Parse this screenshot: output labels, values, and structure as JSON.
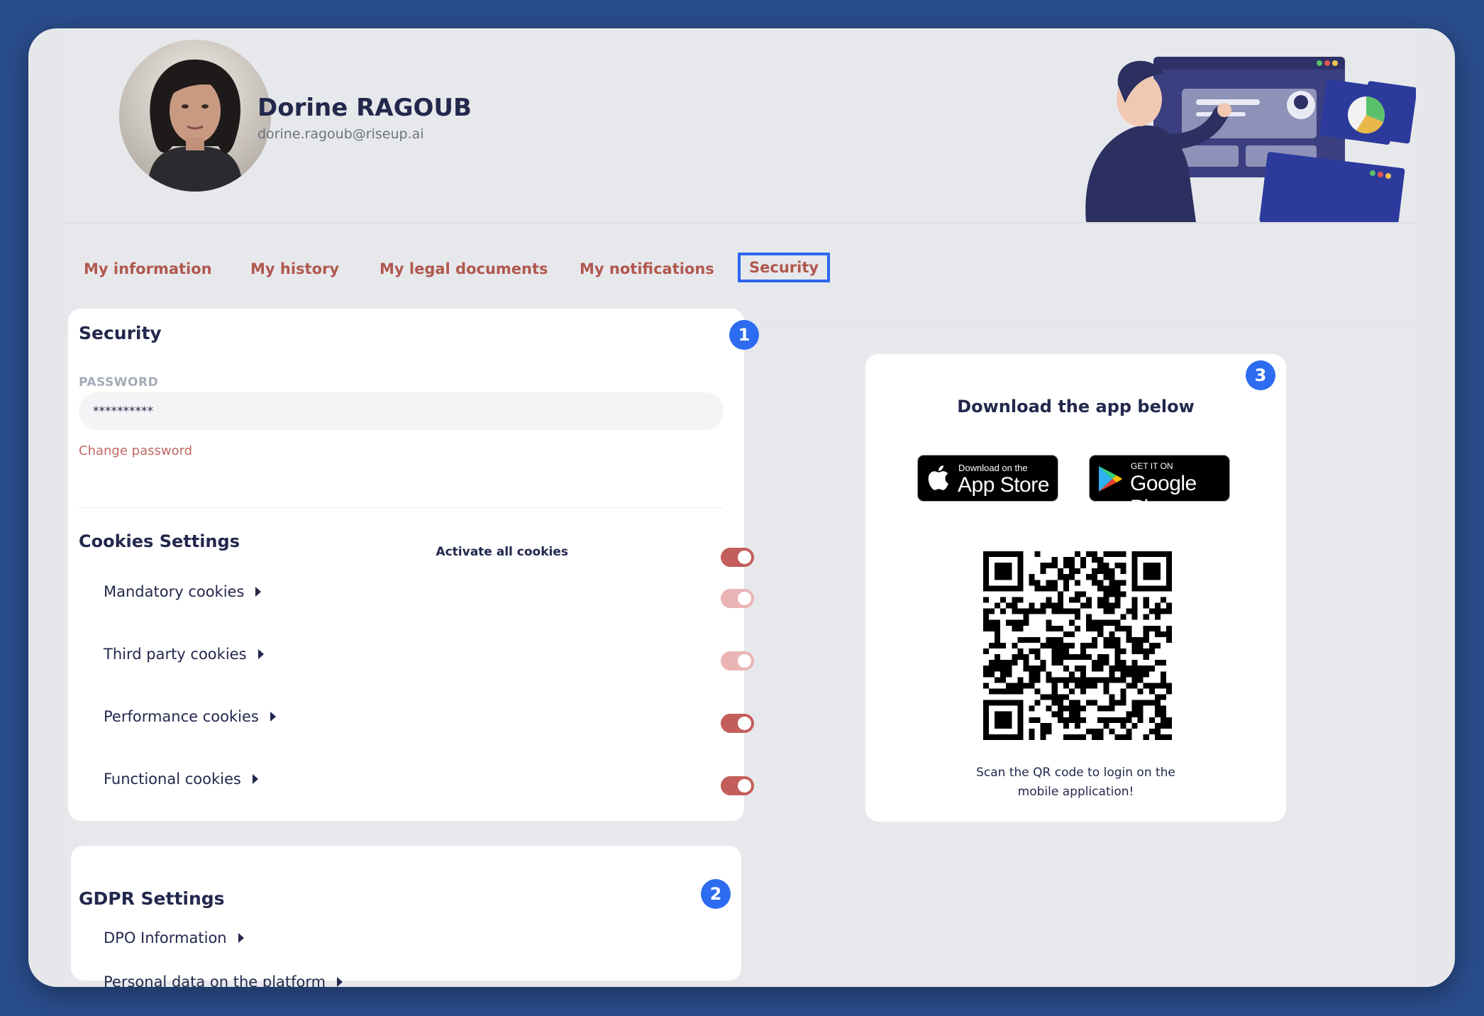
{
  "profile": {
    "name": "Dorine RAGOUB",
    "email": "dorine.ragoub@riseup.ai"
  },
  "tabs": [
    {
      "label": "My information",
      "active": false
    },
    {
      "label": "My history",
      "active": false
    },
    {
      "label": "My legal documents",
      "active": false
    },
    {
      "label": "My notifications",
      "active": false
    },
    {
      "label": "Security",
      "active": true
    }
  ],
  "security": {
    "badge": "1",
    "title": "Security",
    "password_label": "PASSWORD",
    "password_value": "**********",
    "change_password": "Change password",
    "cookies_title": "Cookies Settings",
    "activate_all": {
      "label": "Activate all cookies",
      "state": "on"
    },
    "cookies": [
      {
        "label": "Mandatory cookies",
        "state": "locked"
      },
      {
        "label": "Third party cookies",
        "state": "locked"
      },
      {
        "label": "Performance cookies",
        "state": "on"
      },
      {
        "label": "Functional cookies",
        "state": "on"
      }
    ]
  },
  "gdpr": {
    "badge": "2",
    "title": "GDPR Settings",
    "items": [
      "DPO Information",
      "Personal data on the platform"
    ]
  },
  "app": {
    "badge": "3",
    "title": "Download the app below",
    "app_store": {
      "small": "Download on the",
      "big": "App Store"
    },
    "google_play": {
      "small": "GET IT ON",
      "big": "Google Play"
    },
    "caption_line1": "Scan the QR code to login on the",
    "caption_line2": "mobile application!"
  },
  "colors": {
    "accent_tab": "#b0584f",
    "active_outline": "#2c66f0",
    "toggle_on": "#c35e5b",
    "toggle_locked": "#ebb4b4",
    "badge": "#2d6cf0",
    "background": "#2a4d8c"
  }
}
